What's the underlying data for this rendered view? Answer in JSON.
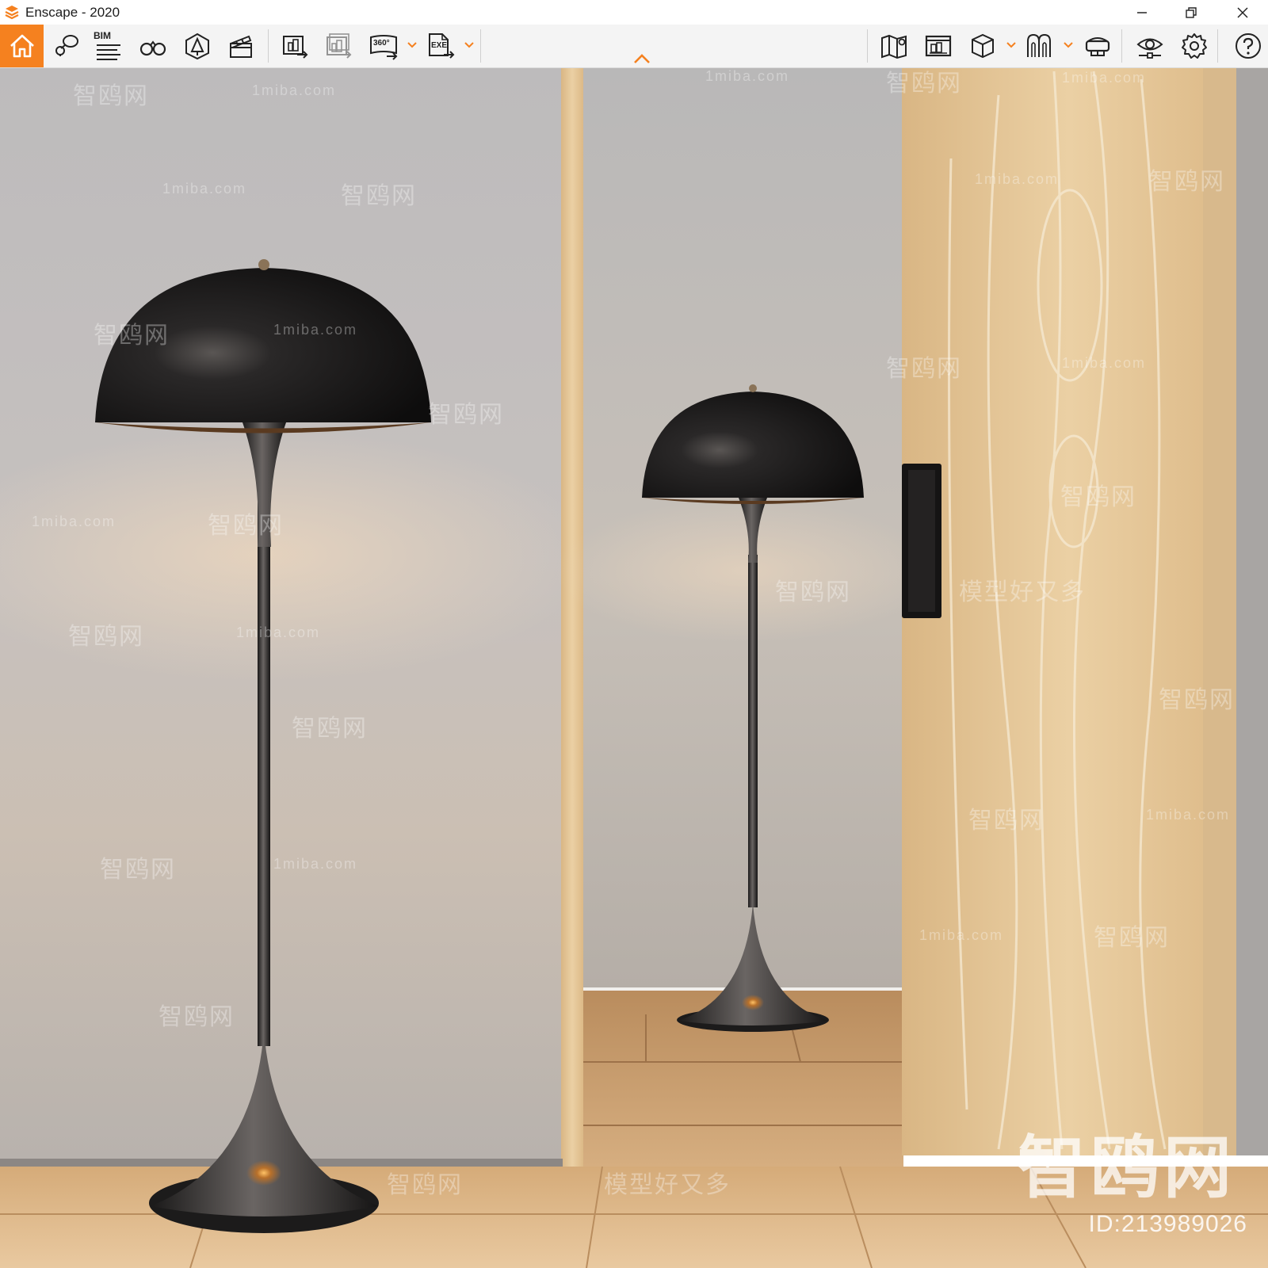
{
  "window": {
    "title": "Enscape - 2020",
    "controls": [
      "minimize-icon",
      "restore-icon",
      "close-icon"
    ]
  },
  "toolbar": {
    "accent_color": "#f5811f",
    "bim_label": "BIM",
    "badge_360": "360°",
    "badge_exe": "EXE",
    "left_buttons": [
      "home-icon",
      "views-pin-icon",
      "bim-list-icon",
      "binoculars-icon",
      "asset-library-icon",
      "video-editor-icon",
      "render-image-icon",
      "batch-render-icon",
      "panorama-360-icon",
      "export-exe-icon"
    ],
    "right_buttons": [
      "map-icon",
      "web-standalone-icon",
      "cube-icon",
      "collaboration-icon",
      "vr-headset-icon",
      "visual-settings-icon",
      "settings-gear-icon",
      "help-icon"
    ]
  },
  "watermarks": {
    "site_cn": "智鸥网",
    "site_domain": "1miba.com",
    "slogan": "模型好又多",
    "big_logo": "智鸥网",
    "id_text": "ID:213989026"
  },
  "scene": {
    "wall_color": "#c9c5c3",
    "wood_color": "#e3c393",
    "floor_color": "#e0b98a"
  }
}
